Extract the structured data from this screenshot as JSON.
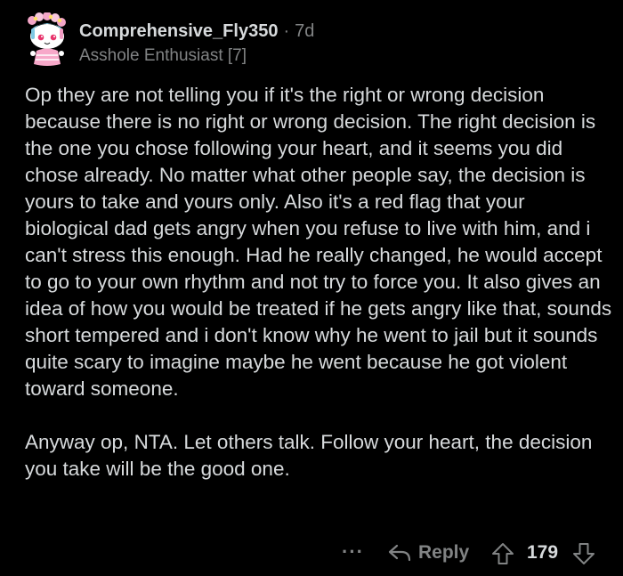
{
  "comment": {
    "author": "Comprehensive_Fly350",
    "separator": "·",
    "age": "7d",
    "flair": "Asshole Enthusiast [7]",
    "paragraphs": [
      "Op they are not telling you if it's the right or wrong decision because there is no right or wrong decision. The right decision is the one you chose following your heart, and it seems you did chose already. No matter what other people say, the decision is yours to take and yours only. Also it's a red flag that your biological dad gets angry when you refuse to live with him, and i can't stress this enough. Had he really changed, he would accept to go to your own rhythm and not try to force you. It also gives an idea of how you would be treated if he gets angry like that, sounds short tempered and i don't know why he went to jail but it sounds quite scary to imagine maybe he went because he got violent toward someone.",
      "Anyway op, NTA. Let others talk. Follow your heart, the decision you take will be the good one."
    ]
  },
  "actions": {
    "more_label": "···",
    "reply_label": "Reply",
    "score": "179",
    "reply_icon": "reply-arrow-icon",
    "upvote_icon": "upvote-arrow-icon",
    "downvote_icon": "downvote-arrow-icon"
  },
  "colors": {
    "background": "#000000",
    "text": "#d7dadc",
    "muted": "#818384"
  }
}
